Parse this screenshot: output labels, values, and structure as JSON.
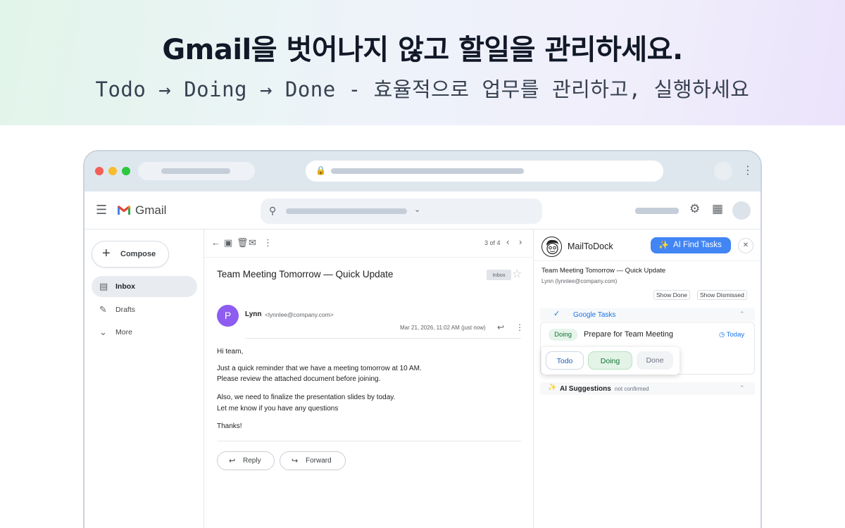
{
  "hero": {
    "headline": "Gmail을 벗어나지 않고 할일을 관리하세요.",
    "subline": "Todo → Doing → Done - 효율적으로 업무를 관리하고, 실행하세요"
  },
  "gmail": {
    "app_name": "Gmail",
    "compose_label": "Compose",
    "nav": [
      {
        "label": "Inbox",
        "icon": "inbox-icon",
        "active": true
      },
      {
        "label": "Drafts",
        "icon": "draft-icon",
        "active": false
      },
      {
        "label": "More",
        "icon": "chevron-down-icon",
        "active": false
      }
    ]
  },
  "email": {
    "pager": "3 of 4",
    "subject": "Team Meeting Tomorrow — Quick Update",
    "tag": "Inbox",
    "sender_initial": "P",
    "sender_name": "Lynn",
    "sender_email": "<lynnlee@company.com>",
    "date": "Mar 21, 2026, 11:02 AM (just now)",
    "body": [
      "Hi team,",
      "Just a quick reminder that we have a meeting tomorrow at 10 AM.",
      " Please review the attached document before joining.",
      "Also, we need to finalize the presentation slides by today.",
      " Let me know if you have any questions",
      "Thanks!"
    ],
    "reply_label": "Reply",
    "forward_label": "Forward"
  },
  "panel": {
    "app_name": "MailToDock",
    "ai_button": "AI Find Tasks",
    "email_subject": "Team Meeting Tomorrow — Quick Update",
    "email_from": "Lynn (lynnlee@company.com)",
    "show_done": "Show Done",
    "show_dismissed": "Show Dismissed",
    "google_tasks_label": "Google Tasks",
    "task": {
      "status": "Doing",
      "title": "Prepare for Team Meeting",
      "due": "Today"
    },
    "status_options": [
      "Todo",
      "Doing",
      "Done"
    ],
    "ai_suggestions_label": "AI Suggestions",
    "ai_suggestions_note": "not confirmed"
  },
  "colors": {
    "accent": "#4285f4",
    "doing_green": "#137333",
    "avatar_purple": "#8e5cf0"
  }
}
